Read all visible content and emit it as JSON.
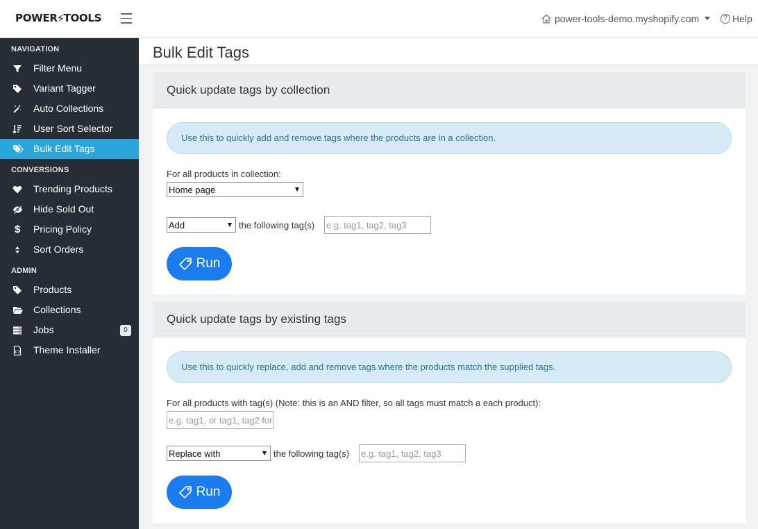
{
  "header": {
    "logo_text_left": "POWER",
    "logo_bolt": "⚡",
    "logo_text_right": "TOOLS",
    "store_name": "power-tools-demo.myshopify.com",
    "help_label": "Help"
  },
  "sidebar": {
    "sections": [
      {
        "title": "NAVIGATION",
        "items": [
          {
            "label": "Filter Menu",
            "icon": "filter-icon"
          },
          {
            "label": "Variant Tagger",
            "icon": "tag-icon"
          },
          {
            "label": "Auto Collections",
            "icon": "magic-wand-icon"
          },
          {
            "label": "User Sort Selector",
            "icon": "sort-icon"
          },
          {
            "label": "Bulk Edit Tags",
            "icon": "tags-icon",
            "active": true
          }
        ]
      },
      {
        "title": "CONVERSIONS",
        "items": [
          {
            "label": "Trending Products",
            "icon": "heart-icon"
          },
          {
            "label": "Hide Sold Out",
            "icon": "eye-slash-icon"
          },
          {
            "label": "Pricing Policy",
            "icon": "dollar-icon"
          },
          {
            "label": "Sort Orders",
            "icon": "sort-arrows-icon"
          }
        ]
      },
      {
        "title": "ADMIN",
        "items": [
          {
            "label": "Products",
            "icon": "tag-icon"
          },
          {
            "label": "Collections",
            "icon": "folder-open-icon"
          },
          {
            "label": "Jobs",
            "icon": "server-icon",
            "badge": "0"
          },
          {
            "label": "Theme Installer",
            "icon": "file-code-icon"
          }
        ]
      }
    ]
  },
  "main": {
    "page_title": "Bulk Edit Tags",
    "collection_card": {
      "title": "Quick update tags by collection",
      "alert": "Use this to quickly add and remove tags where the products are in a collection.",
      "collection_label": "For all products in collection:",
      "collection_value": "Home page",
      "action_value": "Add",
      "following_label": "the following tag(s)",
      "tags_placeholder": "e.g. tag1, tag2, tag3",
      "run_label": "Run"
    },
    "existing_card": {
      "title": "Quick update tags by existing tags",
      "alert": "Use this to quickly replace, add and remove tags where the products match the supplied tags.",
      "filter_label": "For all products with tag(s) (Note: this is an AND filter, so all tags must match a each product):",
      "filter_placeholder": "e.g. tag1, or tag1, tag2 for",
      "action_value": "Replace with",
      "following_label": "the following tag(s)",
      "tags_placeholder": "e.g. tag1, tag2, tag3",
      "run_label": "Run"
    }
  },
  "colors": {
    "sidebar_bg": "#262e35",
    "sidebar_active": "#2aa6dc",
    "button_blue": "#1b7cf0",
    "alert_bg": "#d6ebf5",
    "alert_text": "#2a73a3"
  }
}
